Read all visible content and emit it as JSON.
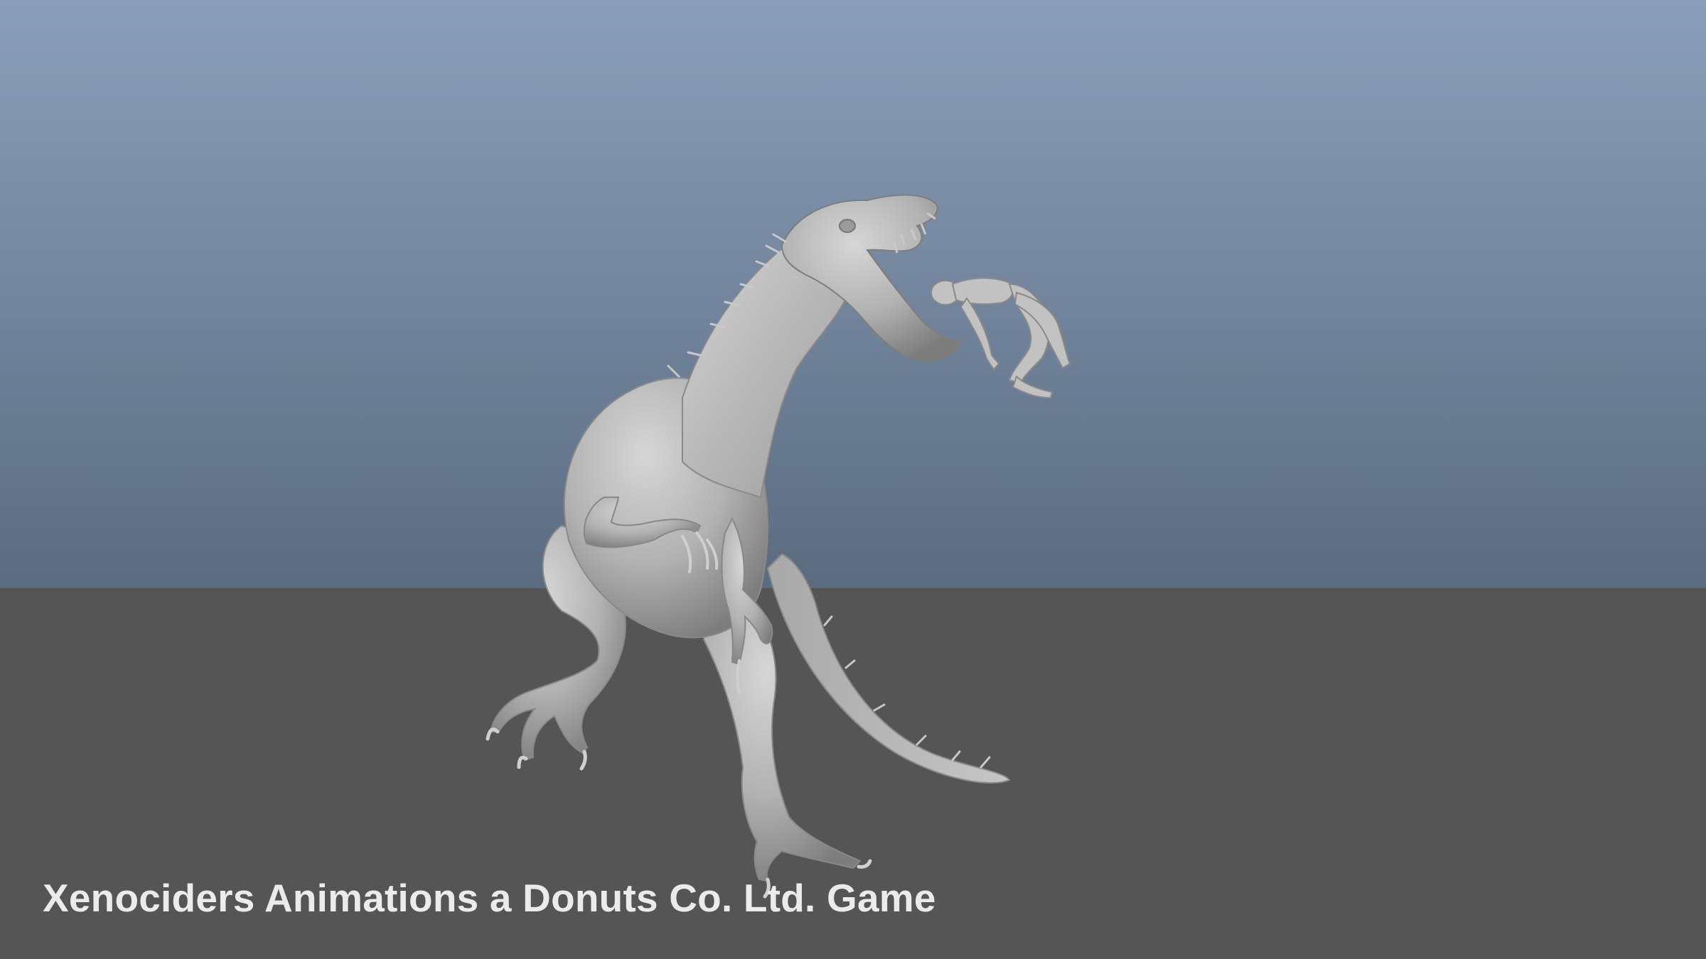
{
  "viewport": {
    "caption": "Xenociders Animations a Donuts Co. Ltd. Game",
    "colors": {
      "sky_top": "#8a9fba",
      "sky_bottom": "#5b6c80",
      "ground": "#555555",
      "model": "#b4b4b4",
      "model_highlight": "#d2d2d2",
      "model_shadow": "#7e7e7e",
      "caption": "#ebebeb"
    }
  },
  "scene": {
    "subjects": [
      "dinosaur-model",
      "human-rig-model"
    ]
  }
}
